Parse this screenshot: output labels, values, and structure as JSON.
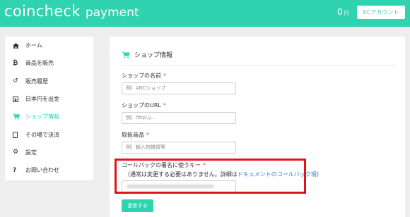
{
  "header": {
    "brand_main": "coincheck",
    "brand_sub": "payment",
    "balance_value": "0",
    "balance_unit": "円",
    "account_button": "ECアカウント"
  },
  "sidebar": {
    "items": [
      {
        "label": "ホーム",
        "icon": "home-icon"
      },
      {
        "label": "商品を販売",
        "icon": "bitcoin-icon"
      },
      {
        "label": "販売履歴",
        "icon": "history-icon"
      },
      {
        "label": "日本円を出金",
        "icon": "withdraw-icon"
      },
      {
        "label": "ショップ情報",
        "icon": "cart-icon",
        "active": true
      },
      {
        "label": "その場で決済",
        "icon": "tablet-icon"
      },
      {
        "label": "設定",
        "icon": "gear-icon"
      },
      {
        "label": "お問い合わせ",
        "icon": "question-icon"
      }
    ]
  },
  "main": {
    "section_title": "ショップ情報",
    "fields": {
      "shop_name": {
        "label": "ショップの名前",
        "required": "*",
        "placeholder": "例）ABCショップ"
      },
      "shop_url": {
        "label": "ショップのURL",
        "required": "*",
        "placeholder": "例）http://..."
      },
      "products": {
        "label": "取扱商品",
        "required": "*",
        "placeholder": "例）輸入物雑貨等"
      },
      "callback_key": {
        "label": "コールバックの署名に使うキー",
        "required": "*",
        "hint_prefix": "（通常は変更する必要はありません。詳細は",
        "hint_link": "ドキュメントのコールバック項",
        "hint_suffix": "）"
      }
    },
    "update_button": "更新する"
  },
  "colors": {
    "accent": "#2fd3b0",
    "required": "#e74c3c",
    "link": "#2a7fd4",
    "highlight": "#e0141c"
  }
}
